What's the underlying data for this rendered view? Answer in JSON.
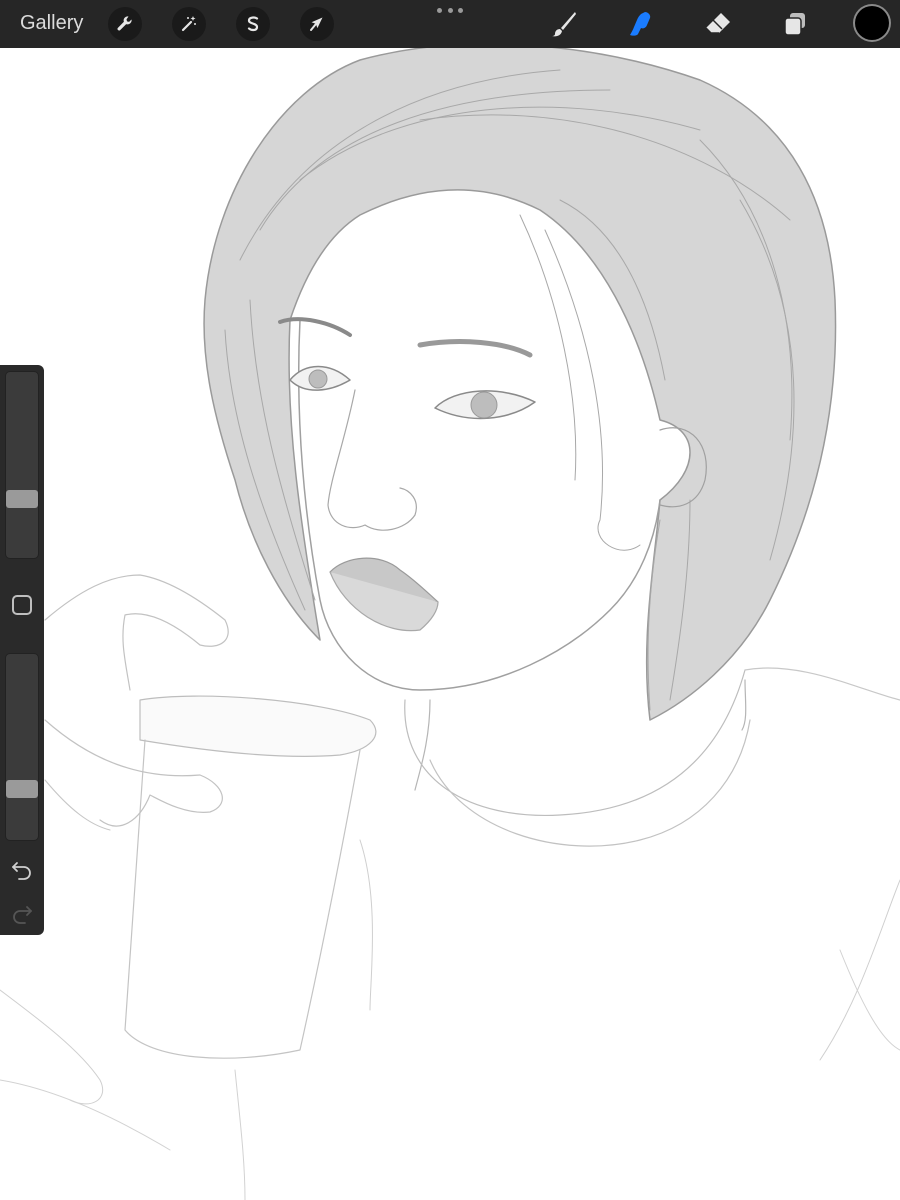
{
  "topbar": {
    "gallery_label": "Gallery",
    "left_tools": [
      {
        "name": "actions",
        "icon": "wrench-icon"
      },
      {
        "name": "adjustments",
        "icon": "magic-wand-icon"
      },
      {
        "name": "selection",
        "icon": "selection-s-icon"
      },
      {
        "name": "transform",
        "icon": "arrow-cursor-icon"
      }
    ],
    "right_tools": [
      {
        "name": "brush",
        "icon": "brush-icon",
        "active": false
      },
      {
        "name": "smudge",
        "icon": "smudge-finger-icon",
        "active": true
      },
      {
        "name": "eraser",
        "icon": "eraser-icon",
        "active": false
      },
      {
        "name": "layers",
        "icon": "layers-icon",
        "active": false
      }
    ],
    "current_color": "#000000",
    "accent_color": "#1a7cff"
  },
  "sidebar": {
    "brush_size_level": 0.3,
    "opacity_level": 0.25,
    "undo_icon": "undo-icon",
    "redo_icon": "redo-icon"
  },
  "canvas": {
    "background": "#ffffff",
    "artwork": "pencil-sketch-portrait"
  }
}
